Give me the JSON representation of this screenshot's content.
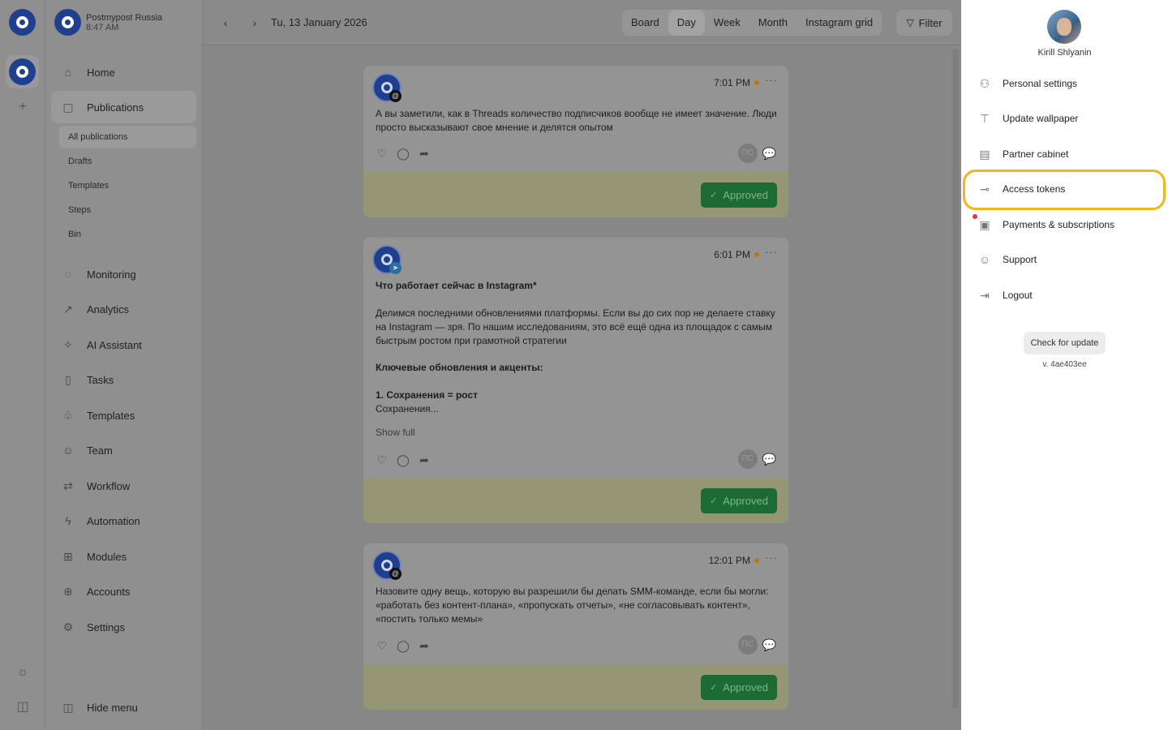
{
  "workspace": {
    "name": "Postmypost Russia",
    "time": "8:47 AM"
  },
  "sidebar": {
    "items_top": [
      {
        "label": "Home",
        "icon": "home-icon"
      },
      {
        "label": "Publications",
        "icon": "calendar-icon"
      }
    ],
    "sub_items": [
      "All publications",
      "Drafts",
      "Templates",
      "Steps",
      "Bin"
    ],
    "items": [
      {
        "label": "Monitoring",
        "icon": "monitoring-icon"
      },
      {
        "label": "Analytics",
        "icon": "analytics-icon"
      },
      {
        "label": "AI Assistant",
        "icon": "sparkle-icon"
      },
      {
        "label": "Tasks",
        "icon": "tasks-icon"
      },
      {
        "label": "Templates",
        "icon": "templates-icon"
      },
      {
        "label": "Team",
        "icon": "team-icon"
      },
      {
        "label": "Workflow",
        "icon": "workflow-icon"
      },
      {
        "label": "Automation",
        "icon": "lightning-icon"
      },
      {
        "label": "Modules",
        "icon": "modules-icon"
      },
      {
        "label": "Accounts",
        "icon": "accounts-icon"
      },
      {
        "label": "Settings",
        "icon": "gear-icon"
      }
    ],
    "hide_menu": "Hide menu"
  },
  "topbar": {
    "date": "Tu, 13 January 2026",
    "views": [
      "Board",
      "Day",
      "Week",
      "Month",
      "Instagram grid"
    ],
    "active_view": "Day",
    "filter": "Filter"
  },
  "posts": [
    {
      "time": "7:01 PM",
      "text": "А вы заметили, как в Threads количество подписчиков вообще не имеет значение. Люди просто высказывают свое мнение и делятся опытом",
      "status": "Approved"
    },
    {
      "time": "6:01 PM",
      "heading": "Что работает сейчас в Instagram*",
      "text": "Делимся последними обновлениями платформы. Если вы до сих пор не делаете ставку на Instagram — зря. По нашим исследованиям, это всё ещё одна из площадок с самым быстрым ростом при грамотной стратегии",
      "subheading": "Ключевые обновления и акценты:",
      "point": "1. Сохранения = рост",
      "snippet": "Сохранения...",
      "show_full": "Show full",
      "status": "Approved"
    },
    {
      "time": "12:01 PM",
      "text": "Назовите одну вещь, которую вы разрешили бы делать SMM-команде, если бы могли: «работать без контент-плана», «пропускать отчеты», «не согласовывать контент», «постить только мемы»",
      "status": "Approved"
    }
  ],
  "author_initials": "ПС",
  "panel": {
    "user_name": "Kirill Shlyanin",
    "menu": [
      {
        "label": "Personal settings",
        "icon": "user-icon"
      },
      {
        "label": "Update wallpaper",
        "icon": "paint-roller-icon"
      },
      {
        "label": "Partner cabinet",
        "icon": "partner-icon"
      },
      {
        "label": "Access tokens",
        "icon": "key-icon"
      },
      {
        "label": "Payments & subscriptions",
        "icon": "receipt-icon"
      },
      {
        "label": "Support",
        "icon": "support-icon"
      },
      {
        "label": "Logout",
        "icon": "logout-icon"
      }
    ],
    "check_update": "Check for update",
    "version": "v. 4ae403ee"
  },
  "colors": {
    "highlight": "#f3b51b",
    "approved": "#1c6b34",
    "brand": "#1f3f8f"
  }
}
